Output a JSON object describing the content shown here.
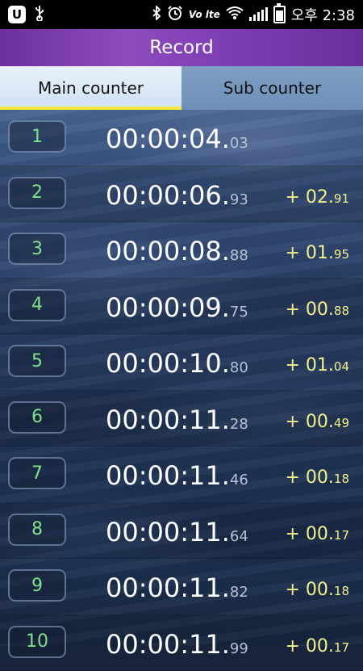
{
  "status_bar": {
    "left_icons": [
      "app-notification-icon",
      "usb-icon"
    ],
    "app_badge": "U",
    "right_icons": [
      "bluetooth-icon",
      "alarm-icon",
      "volte-icon",
      "wifi-icon",
      "signal-icon",
      "battery-charging-icon"
    ],
    "volte_label": "Vo lte",
    "time": "오후 2:38"
  },
  "header": {
    "title": "Record"
  },
  "tabs": [
    {
      "label": "Main counter",
      "active": true
    },
    {
      "label": "Sub counter",
      "active": false
    }
  ],
  "colors": {
    "header_purple": "#7c3db2",
    "tab_indicator": "#f0ea3a",
    "index_green": "#7fe08c",
    "delta_yellow": "#f2f08a"
  },
  "records": [
    {
      "index": "1",
      "time_main": "00:00:04.",
      "time_frac": "03",
      "delta_main": "",
      "delta_frac": ""
    },
    {
      "index": "2",
      "time_main": "00:00:06.",
      "time_frac": "93",
      "delta_main": "+ 02.",
      "delta_frac": "91"
    },
    {
      "index": "3",
      "time_main": "00:00:08.",
      "time_frac": "88",
      "delta_main": "+ 01.",
      "delta_frac": "95"
    },
    {
      "index": "4",
      "time_main": "00:00:09.",
      "time_frac": "75",
      "delta_main": "+ 00.",
      "delta_frac": "88"
    },
    {
      "index": "5",
      "time_main": "00:00:10.",
      "time_frac": "80",
      "delta_main": "+ 01.",
      "delta_frac": "04"
    },
    {
      "index": "6",
      "time_main": "00:00:11.",
      "time_frac": "28",
      "delta_main": "+ 00.",
      "delta_frac": "49"
    },
    {
      "index": "7",
      "time_main": "00:00:11.",
      "time_frac": "46",
      "delta_main": "+ 00.",
      "delta_frac": "18"
    },
    {
      "index": "8",
      "time_main": "00:00:11.",
      "time_frac": "64",
      "delta_main": "+ 00.",
      "delta_frac": "17"
    },
    {
      "index": "9",
      "time_main": "00:00:11.",
      "time_frac": "82",
      "delta_main": "+ 00.",
      "delta_frac": "18"
    },
    {
      "index": "10",
      "time_main": "00:00:11.",
      "time_frac": "99",
      "delta_main": "+ 00.",
      "delta_frac": "17"
    }
  ]
}
